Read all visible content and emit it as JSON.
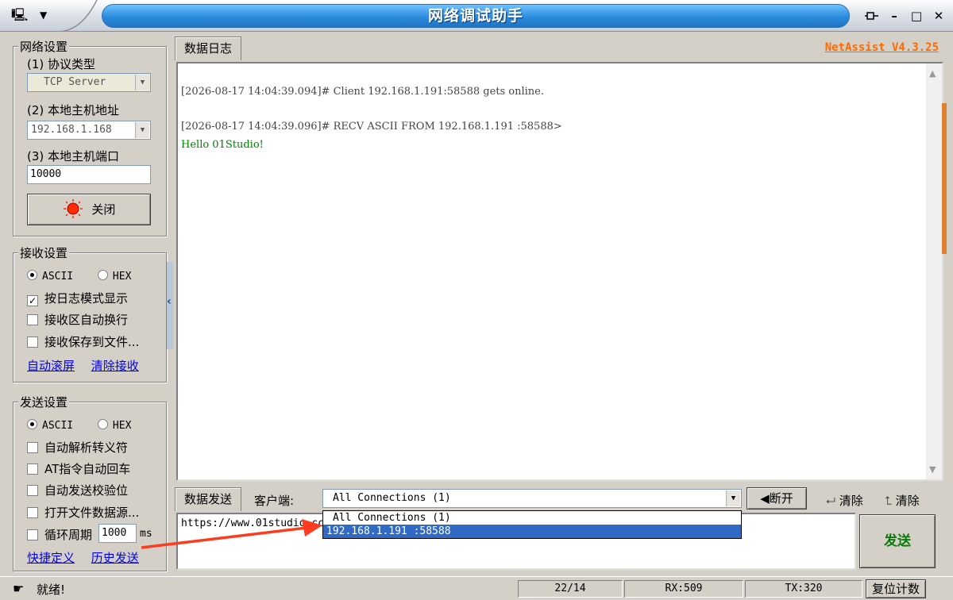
{
  "window": {
    "title": "网络调试助手",
    "pin_icon": "pin-icon",
    "minimize": "–",
    "maximize": "□",
    "close": "✕"
  },
  "network": {
    "group_title": "网络设置",
    "protocol_label": "(1) 协议类型",
    "protocol_value": "TCP Server",
    "host_label": "(2) 本地主机地址",
    "host_value": "192.168.1.168",
    "port_label": "(3) 本地主机端口",
    "port_value": "10000",
    "close_button": "关闭"
  },
  "receive": {
    "group_title": "接收设置",
    "ascii": "ASCII",
    "hex": "HEX",
    "log_mode": "按日志模式显示",
    "auto_wrap": "接收区自动换行",
    "save_file": "接收保存到文件...",
    "auto_scroll": "自动滚屏",
    "clear_receive": "清除接收"
  },
  "send": {
    "group_title": "发送设置",
    "ascii": "ASCII",
    "hex": "HEX",
    "parse_escape": "自动解析转义符",
    "at_newline": "AT指令自动回车",
    "checksum": "自动发送校验位",
    "open_file": "打开文件数据源...",
    "cycle_label": "循环周期",
    "cycle_value": "1000",
    "cycle_unit": "ms",
    "shortcut": "快捷定义",
    "history": "历史发送"
  },
  "log": {
    "tab": "数据日志",
    "version": "NetAssist V4.3.25",
    "lines": [
      "[2026-08-17 14:04:39.094]# Client 192.168.1.191:58588 gets online.",
      "[2026-08-17 14:04:39.096]# RECV ASCII FROM 192.168.1.191 :58588>",
      "Hello 01Studio!"
    ]
  },
  "send_area": {
    "tab": "数据发送",
    "client_label": "客户端:",
    "client_selected": "All Connections (1)",
    "disconnect": "断开",
    "clear1": "清除",
    "clear2": "清除",
    "input_value": "https://www.01studio.cc",
    "dropdown_options": [
      "All Connections (1)",
      "192.168.1.191 :58588"
    ],
    "send_button": "发送"
  },
  "status": {
    "text": "就绪!",
    "count": "22/14",
    "rx": "RX:509",
    "tx": "TX:320",
    "reset": "复位计数"
  },
  "colors": {
    "accent": "#2b8bdc",
    "version": "#ff6a00",
    "green_text": "#008000",
    "selection": "#316ac5",
    "annotation_arrow": "#ff3b1f"
  }
}
